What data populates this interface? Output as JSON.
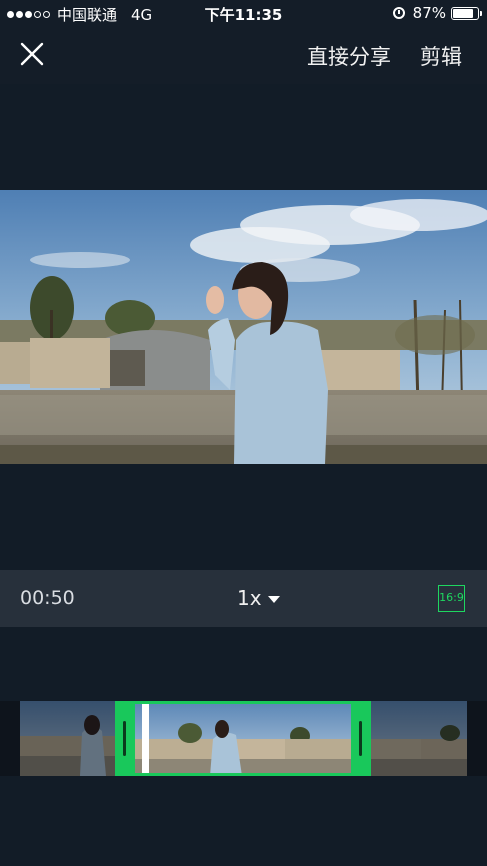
{
  "status_bar": {
    "carrier": "中国联通",
    "network": "4G",
    "time": "下午11:35",
    "battery": "87%",
    "battery_level": 0.87,
    "signal_bars_filled": 3,
    "signal_bars_total": 5,
    "icons": [
      "signal-dots-icon",
      "alarm-icon",
      "battery-icon"
    ]
  },
  "nav": {
    "close_icon": "close-icon",
    "share_label": "直接分享",
    "edit_label": "剪辑"
  },
  "preview": {
    "aspect": "16:9",
    "image": "video-frame-woman-standing-by-greenhouse"
  },
  "controls": {
    "timecode": "00:50",
    "speed": "1x",
    "ratio_label": "16:9"
  },
  "timeline": {
    "frames": 9,
    "selection_start_fraction": 0.24,
    "selection_end_fraction": 0.76,
    "playhead_fraction": 0.29
  },
  "colors": {
    "background": "#141d28",
    "control_bar": "#27303b",
    "accent_green": "#19c85b"
  }
}
